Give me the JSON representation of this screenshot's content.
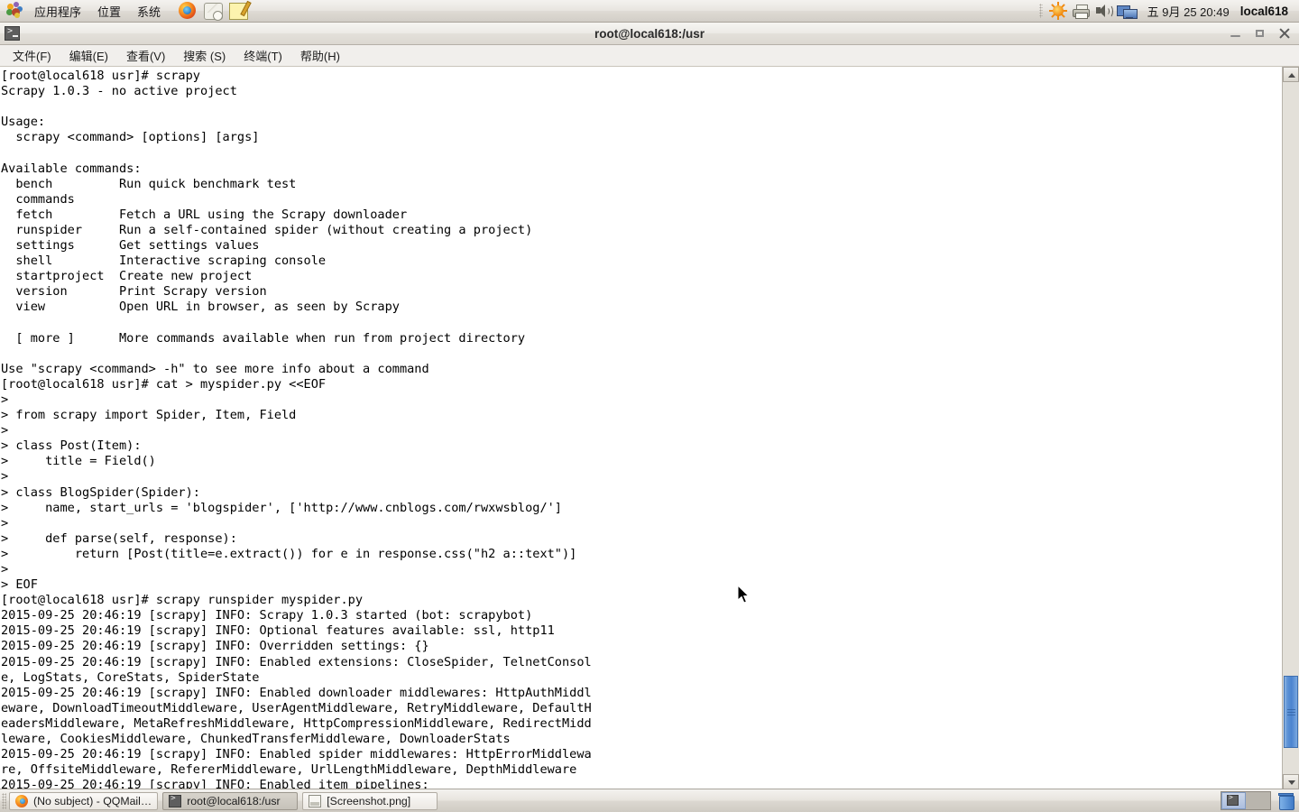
{
  "top_panel": {
    "menus": [
      "应用程序",
      "位置",
      "系统"
    ],
    "launchers": [
      {
        "name": "firefox-launcher",
        "title": "Firefox"
      },
      {
        "name": "help-launcher",
        "title": "帮助"
      },
      {
        "name": "notes-launcher",
        "title": "记事本"
      }
    ],
    "tray": [
      "update-icon",
      "printer-icon",
      "volume-icon",
      "network-icon"
    ],
    "clock": "五 9月 25 20:49",
    "hostname": "local618"
  },
  "window": {
    "title": "root@local618:/usr",
    "icon": "terminal-icon",
    "buttons": {
      "minimize": "最小化",
      "maximize": "最大化",
      "close": "关闭"
    },
    "menubar": [
      "文件(F)",
      "编辑(E)",
      "查看(V)",
      "搜索 (S)",
      "终端(T)",
      "帮助(H)"
    ]
  },
  "terminal": {
    "content": "[root@local618 usr]# scrapy\nScrapy 1.0.3 - no active project\n\nUsage:\n  scrapy <command> [options] [args]\n\nAvailable commands:\n  bench         Run quick benchmark test\n  commands\n  fetch         Fetch a URL using the Scrapy downloader\n  runspider     Run a self-contained spider (without creating a project)\n  settings      Get settings values\n  shell         Interactive scraping console\n  startproject  Create new project\n  version       Print Scrapy version\n  view          Open URL in browser, as seen by Scrapy\n\n  [ more ]      More commands available when run from project directory\n\nUse \"scrapy <command> -h\" to see more info about a command\n[root@local618 usr]# cat > myspider.py <<EOF\n> \n> from scrapy import Spider, Item, Field\n> \n> class Post(Item):\n>     title = Field()\n> \n> class BlogSpider(Spider):\n>     name, start_urls = 'blogspider', ['http://www.cnblogs.com/rwxwsblog/']\n> \n>     def parse(self, response):\n>         return [Post(title=e.extract()) for e in response.css(\"h2 a::text\")]\n> \n> EOF\n[root@local618 usr]# scrapy runspider myspider.py\n2015-09-25 20:46:19 [scrapy] INFO: Scrapy 1.0.3 started (bot: scrapybot)\n2015-09-25 20:46:19 [scrapy] INFO: Optional features available: ssl, http11\n2015-09-25 20:46:19 [scrapy] INFO: Overridden settings: {}\n2015-09-25 20:46:19 [scrapy] INFO: Enabled extensions: CloseSpider, TelnetConsol\ne, LogStats, CoreStats, SpiderState\n2015-09-25 20:46:19 [scrapy] INFO: Enabled downloader middlewares: HttpAuthMiddl\neware, DownloadTimeoutMiddleware, UserAgentMiddleware, RetryMiddleware, DefaultH\neadersMiddleware, MetaRefreshMiddleware, HttpCompressionMiddleware, RedirectMidd\nleware, CookiesMiddleware, ChunkedTransferMiddleware, DownloaderStats\n2015-09-25 20:46:19 [scrapy] INFO: Enabled spider middlewares: HttpErrorMiddlewa\nre, OffsiteMiddleware, RefererMiddleware, UrlLengthMiddleware, DepthMiddleware\n2015-09-25 20:46:19 [scrapy] INFO: Enabled item pipelines:"
  },
  "taskbar": {
    "items": [
      {
        "label": "(No subject) - QQMail…",
        "icon": "firefox-icon",
        "active": false
      },
      {
        "label": "root@local618:/usr",
        "icon": "terminal-icon",
        "active": true
      },
      {
        "label": "[Screenshot.png]",
        "icon": "image-viewer-icon",
        "active": false
      }
    ],
    "workspaces": [
      {
        "label": "1",
        "active": true
      },
      {
        "label": "2",
        "active": false
      }
    ],
    "trash": "回收站"
  },
  "colors": {
    "panel_bg": "#e8e5e0",
    "terminal_bg": "#ffffff",
    "terminal_fg": "#000000",
    "scrollbar_thumb": "#4b84cf",
    "title_fg": "#2b2b2b"
  }
}
